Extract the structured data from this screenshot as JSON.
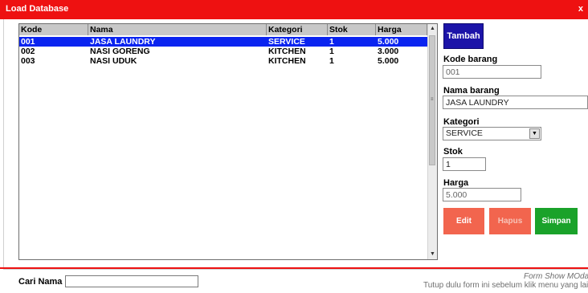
{
  "window": {
    "title": "Load Database",
    "close": "x"
  },
  "grid": {
    "columns": [
      "Kode",
      "Nama",
      "Kategori",
      "Stok",
      "Harga"
    ],
    "rows": [
      [
        "001",
        "JASA LAUNDRY",
        "SERVICE",
        "1",
        "5.000"
      ],
      [
        "002",
        "NASI GORENG",
        "KITCHEN",
        "1",
        "3.000"
      ],
      [
        "003",
        "NASI UDUK",
        "KITCHEN",
        "1",
        "5.000"
      ]
    ],
    "selected_row": 0
  },
  "form": {
    "tambah_label": "Tambah",
    "kode_label": "Kode barang",
    "kode_value": "001",
    "nama_label": "Nama barang",
    "nama_value": "JASA LAUNDRY",
    "kategori_label": "Kategori",
    "kategori_value": "SERVICE",
    "stok_label": "Stok",
    "stok_value": "1",
    "harga_label": "Harga",
    "harga_value": "5.000"
  },
  "actions": {
    "edit": "Edit",
    "hapus": "Hapus",
    "simpan": "Simpan"
  },
  "search": {
    "label": "Cari Nama",
    "value": ""
  },
  "notes": {
    "line1": "Form Show MOda",
    "line2": "Tutup dulu form ini sebelum klik menu yang lai"
  },
  "colors": {
    "titlebar": "#ee1111",
    "selection": "#0a24f0",
    "tambah": "#1c14a8",
    "edit": "#f2654e",
    "simpan": "#1aa22a"
  }
}
